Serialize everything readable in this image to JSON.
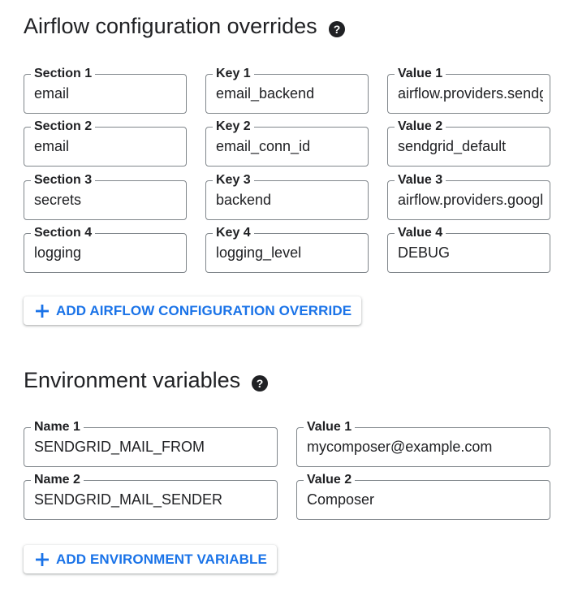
{
  "airflow": {
    "title": "Airflow configuration overrides",
    "help_icon": "help-circle-icon",
    "rows": [
      {
        "section_label": "Section 1",
        "section_value": "email",
        "key_label": "Key 1",
        "key_value": "email_backend",
        "value_label": "Value 1",
        "value_value": "airflow.providers.sendgrid.utils.emailer.send_email"
      },
      {
        "section_label": "Section 2",
        "section_value": "email",
        "key_label": "Key 2",
        "key_value": "email_conn_id",
        "value_label": "Value 2",
        "value_value": "sendgrid_default"
      },
      {
        "section_label": "Section 3",
        "section_value": "secrets",
        "key_label": "Key 3",
        "key_value": "backend",
        "value_label": "Value 3",
        "value_value": "airflow.providers.google.cloud.secrets.secret_manager.CloudSecretManagerBackend"
      },
      {
        "section_label": "Section 4",
        "section_value": "logging",
        "key_label": "Key 4",
        "key_value": "logging_level",
        "value_label": "Value 4",
        "value_value": "DEBUG"
      }
    ],
    "add_button_label": "ADD AIRFLOW CONFIGURATION OVERRIDE",
    "add_icon": "plus-icon"
  },
  "env": {
    "title": "Environment variables",
    "help_icon": "help-circle-icon",
    "rows": [
      {
        "name_label": "Name 1",
        "name_value": "SENDGRID_MAIL_FROM",
        "value_label": "Value 1",
        "value_value": "mycomposer@example.com"
      },
      {
        "name_label": "Name 2",
        "name_value": "SENDGRID_MAIL_SENDER",
        "value_label": "Value 2",
        "value_value": "Composer"
      }
    ],
    "add_button_label": "ADD ENVIRONMENT VARIABLE",
    "add_icon": "plus-icon"
  },
  "colors": {
    "text": "#202124",
    "border": "#80868b",
    "accent": "#1a73e8"
  }
}
